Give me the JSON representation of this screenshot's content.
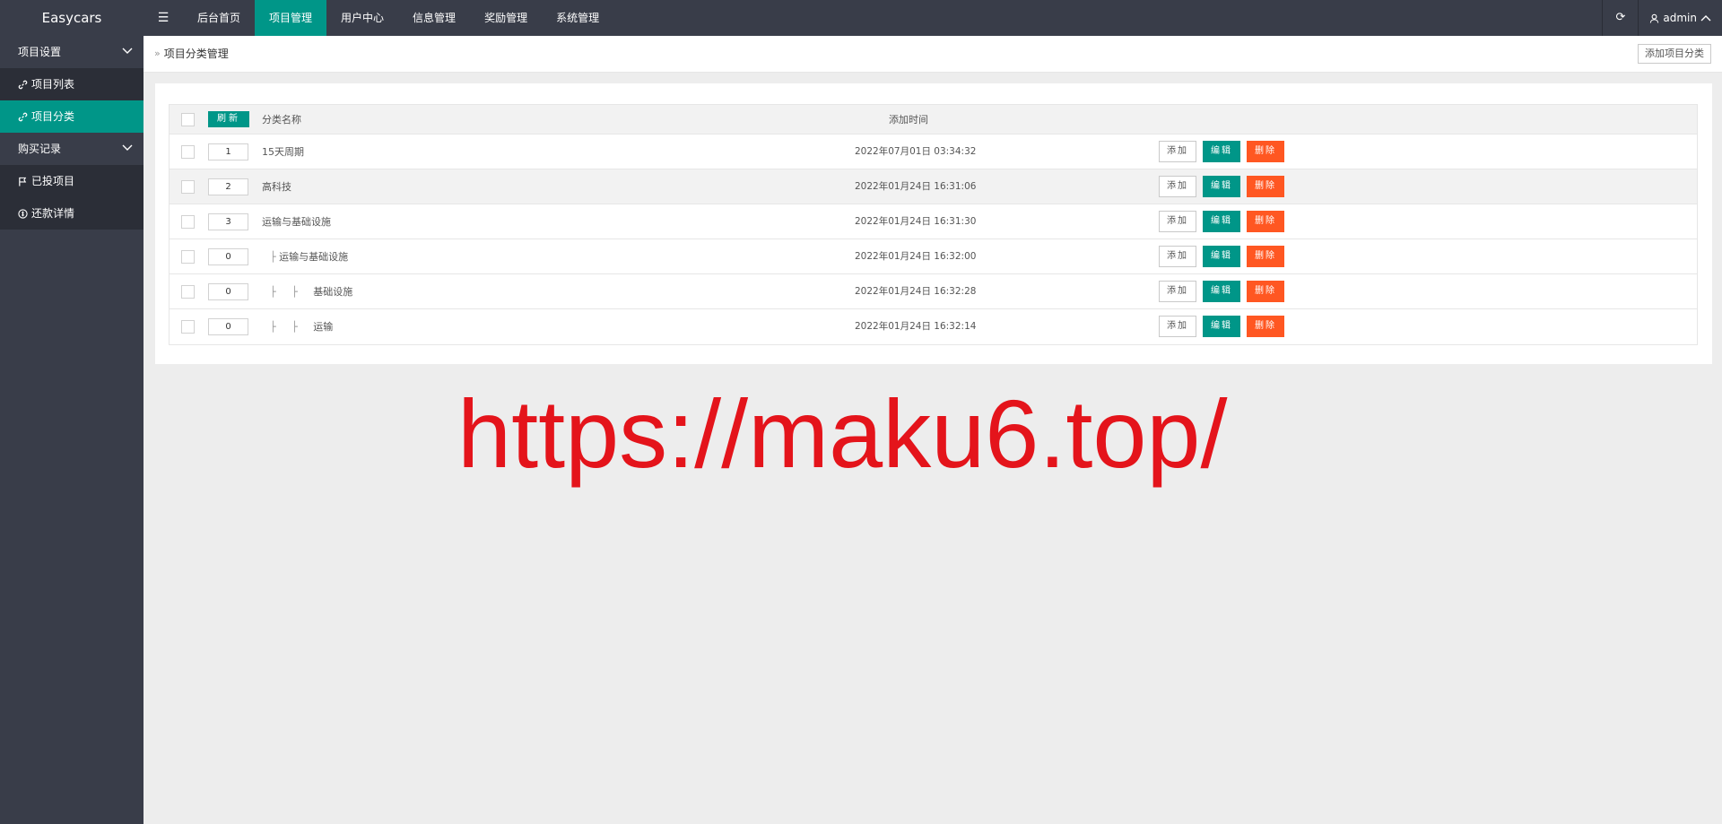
{
  "app": {
    "title": "Easycars"
  },
  "topnav": {
    "items": [
      {
        "label": "后台首页"
      },
      {
        "label": "项目管理"
      },
      {
        "label": "用户中心"
      },
      {
        "label": "信息管理"
      },
      {
        "label": "奖励管理"
      },
      {
        "label": "系统管理"
      }
    ],
    "active_index": 1,
    "user_label": "admin"
  },
  "sidebar": {
    "groups": [
      {
        "label": "项目设置",
        "items": [
          {
            "label": "项目列表",
            "icon": "link-icon"
          },
          {
            "label": "项目分类",
            "icon": "link-icon",
            "active": true
          }
        ]
      },
      {
        "label": "购买记录",
        "items": [
          {
            "label": "已投项目",
            "icon": "flag-icon"
          },
          {
            "label": "还款详情",
            "icon": "coin-icon"
          }
        ]
      }
    ]
  },
  "breadcrumb": {
    "label": "项目分类管理"
  },
  "toolbar": {
    "add_category_label": "添加项目分类"
  },
  "table": {
    "refresh_label": "刷新",
    "headers": {
      "name": "分类名称",
      "time": "添加时间"
    },
    "rows": [
      {
        "sort": "1",
        "prefix": "",
        "name": "15天周期",
        "time": "2022年07月01日 03:34:32"
      },
      {
        "sort": "2",
        "prefix": "",
        "name": "高科技",
        "time": "2022年01月24日 16:31:06"
      },
      {
        "sort": "3",
        "prefix": "",
        "name": "运输与基础设施",
        "time": "2022年01月24日 16:31:30"
      },
      {
        "sort": "0",
        "prefix": "├ ",
        "name": "运输与基础设施",
        "time": "2022年01月24日 16:32:00"
      },
      {
        "sort": "0",
        "prefix": "├ ├ ",
        "name": "基础设施",
        "time": "2022年01月24日 16:32:28"
      },
      {
        "sort": "0",
        "prefix": "├ ├ ",
        "name": "运输",
        "time": "2022年01月24日 16:32:14"
      }
    ],
    "actions": {
      "add": "添加",
      "edit": "编辑",
      "delete": "删除"
    }
  },
  "watermark": {
    "text": "https://maku6.top/"
  },
  "colors": {
    "accent": "#009688",
    "danger": "#ff5722",
    "header_bg": "#393d49",
    "watermark": "#e4141b"
  }
}
